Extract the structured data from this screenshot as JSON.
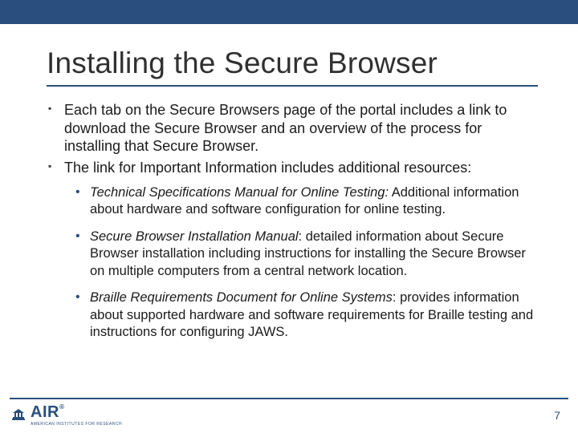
{
  "title": "Installing the Secure Browser",
  "bullets": [
    "Each tab on the Secure Browsers page of the portal includes a link to download the Secure Browser and an overview of the process for installing that Secure Browser.",
    "The link for Important Information includes additional resources:"
  ],
  "sub": [
    {
      "label": "Technical Specifications Manual for Online Testing:",
      "desc": " Additional information about hardware and software configuration for online testing."
    },
    {
      "label": "Secure Browser Installation Manual",
      "desc": ": detailed information about Secure Browser installation including instructions for installing the Secure Browser on multiple computers from a central network location."
    },
    {
      "label": "Braille Requirements Document for Online Systems",
      "desc": ": provides information about supported hardware and software requirements for Braille testing and instructions for configuring JAWS."
    }
  ],
  "logo": {
    "main": "AIR",
    "reg": "®",
    "sub": "AMERICAN INSTITUTES FOR RESEARCH"
  },
  "page": "7"
}
